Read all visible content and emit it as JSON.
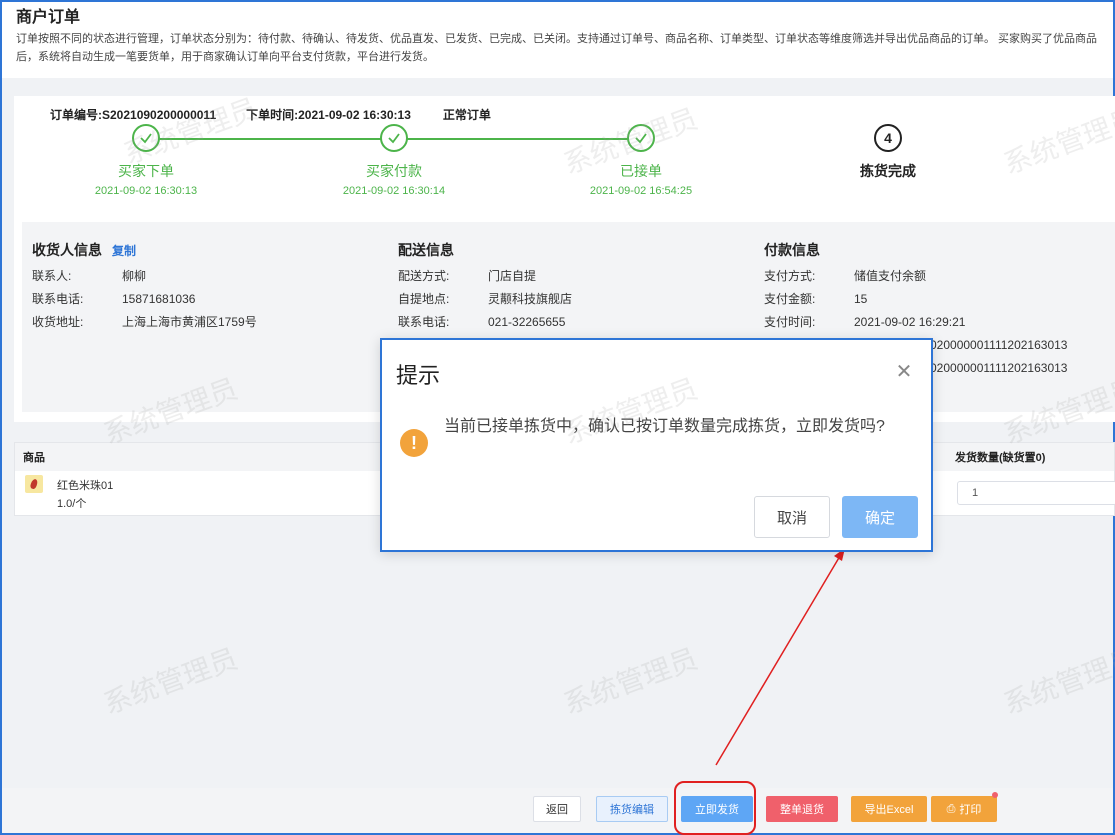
{
  "page": {
    "title": "商户订单",
    "description": "订单按照不同的状态进行管理，订单状态分别为：待付款、待确认、待发货、优品直发、已发货、已完成、已关闭。支持通过订单号、商品名称、订单类型、订单状态等维度筛选并导出优品商品的订单。 买家购买了优品商品后，系统将自动生成一笔要货单，用于商家确认订单向平台支付货款，平台进行发货。"
  },
  "order": {
    "number": "订单编号:S2021090200000011",
    "time": "下单时间:2021-09-02 16:30:13",
    "type": "正常订单"
  },
  "steps": [
    {
      "label": "买家下单",
      "time": "2021-09-02 16:30:13",
      "done": true
    },
    {
      "label": "买家付款",
      "time": "2021-09-02 16:30:14",
      "done": true
    },
    {
      "label": "已接单",
      "time": "2021-09-02 16:54:25",
      "done": true
    },
    {
      "label": "拣货完成",
      "number": "4",
      "done": false
    }
  ],
  "receiver": {
    "title": "收货人信息",
    "copy": "复制",
    "rows": [
      {
        "k": "联系人:",
        "v": "柳柳"
      },
      {
        "k": "联系电话:",
        "v": "15871681036"
      },
      {
        "k": "收货地址:",
        "v": "上海上海市黄浦区1759号"
      }
    ]
  },
  "delivery": {
    "title": "配送信息",
    "rows": [
      {
        "k": "配送方式:",
        "v": "门店自提"
      },
      {
        "k": "自提地点:",
        "v": "灵颟科技旗舰店"
      },
      {
        "k": "联系电话:",
        "v": "021-32265655"
      }
    ]
  },
  "payment": {
    "title": "付款信息",
    "rows": [
      {
        "k": "支付方式:",
        "v": "储值支付余额"
      },
      {
        "k": "支付金额:",
        "v": "15"
      },
      {
        "k": "支付时间:",
        "v": "2021-09-02 16:29:21"
      },
      {
        "k": "",
        "v": "020000001111202163013"
      },
      {
        "k": "",
        "v": "020000001111202163013"
      }
    ]
  },
  "table": {
    "col_goods": "商品",
    "col_qty": "发货数量(缺货置0)",
    "rows": [
      {
        "name": "红色米珠01",
        "spec": "1.0/个",
        "qty": "1"
      }
    ]
  },
  "footer": {
    "back": "返回",
    "pick_edit": "拣货编辑",
    "ship_now": "立即发货",
    "refund_all": "整单退货",
    "export": "导出Excel",
    "print": "打印"
  },
  "dialog": {
    "title": "提示",
    "message": "当前已接单拣货中，确认已按订单数量完成拣货，立即发货吗?",
    "cancel": "取消",
    "confirm": "确定"
  },
  "watermark": "系统管理员",
  "colors": {
    "accent": "#2e75d6",
    "success": "#4cb44a",
    "warning": "#f2a33b",
    "danger": "#f0606b",
    "annotation": "#e02020"
  }
}
